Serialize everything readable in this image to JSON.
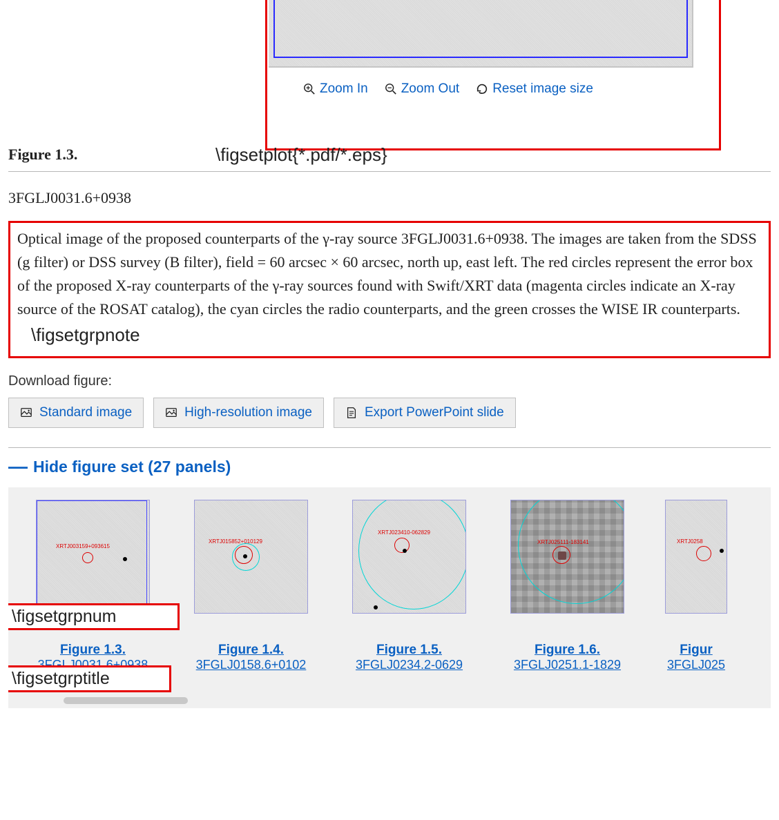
{
  "zoom": {
    "in": "Zoom In",
    "out": "Zoom Out",
    "reset": "Reset image size"
  },
  "figure_label": "Figure 1.3.",
  "figsetplot_annot": "\\figsetplot{*.pdf/*.eps}",
  "figset_title": "3FGLJ0031.6+0938",
  "caption": "Optical image of the proposed counterparts of the γ-ray source 3FGLJ0031.6+0938. The images are taken from the SDSS (g filter) or DSS survey (B filter), field = 60 arcsec × 60 arcsec, north up, east left. The red circles represent the error box of the proposed X-ray counterparts of the γ-ray sources found with Swift/XRT data (magenta circles indicate an X-ray source of the ROSAT catalog), the cyan circles the radio counterparts, and the green crosses the WISE IR counterparts.",
  "figsetgrpnote_annot": "\\figsetgrpnote",
  "download_label": "Download figure:",
  "buttons": {
    "std": "Standard image",
    "hires": "High-resolution image",
    "ppt": "Export PowerPoint slide"
  },
  "hide_label_prefix": "Hide figure set ",
  "hide_label_count": "(27 panels)",
  "figsetgrpnum_annot": "\\figsetgrpnum",
  "figsetgrptitle_annot": "\\figsetgrptitle",
  "panels": [
    {
      "fig": "Figure 1.3.",
      "title": "3FGLJ0031.6+0938",
      "xrt": "XRTJ003159+093615"
    },
    {
      "fig": "Figure 1.4.",
      "title": "3FGLJ0158.6+0102",
      "xrt": "XRTJ015852+010129"
    },
    {
      "fig": "Figure 1.5.",
      "title": "3FGLJ0234.2-0629",
      "xrt": "XRTJ023410-062829"
    },
    {
      "fig": "Figure 1.6.",
      "title": "3FGLJ0251.1-1829",
      "xrt": "XRTJ025111-183141"
    },
    {
      "fig": "Figur",
      "title": "3FGLJ025",
      "xrt": "XRTJ0258"
    }
  ]
}
